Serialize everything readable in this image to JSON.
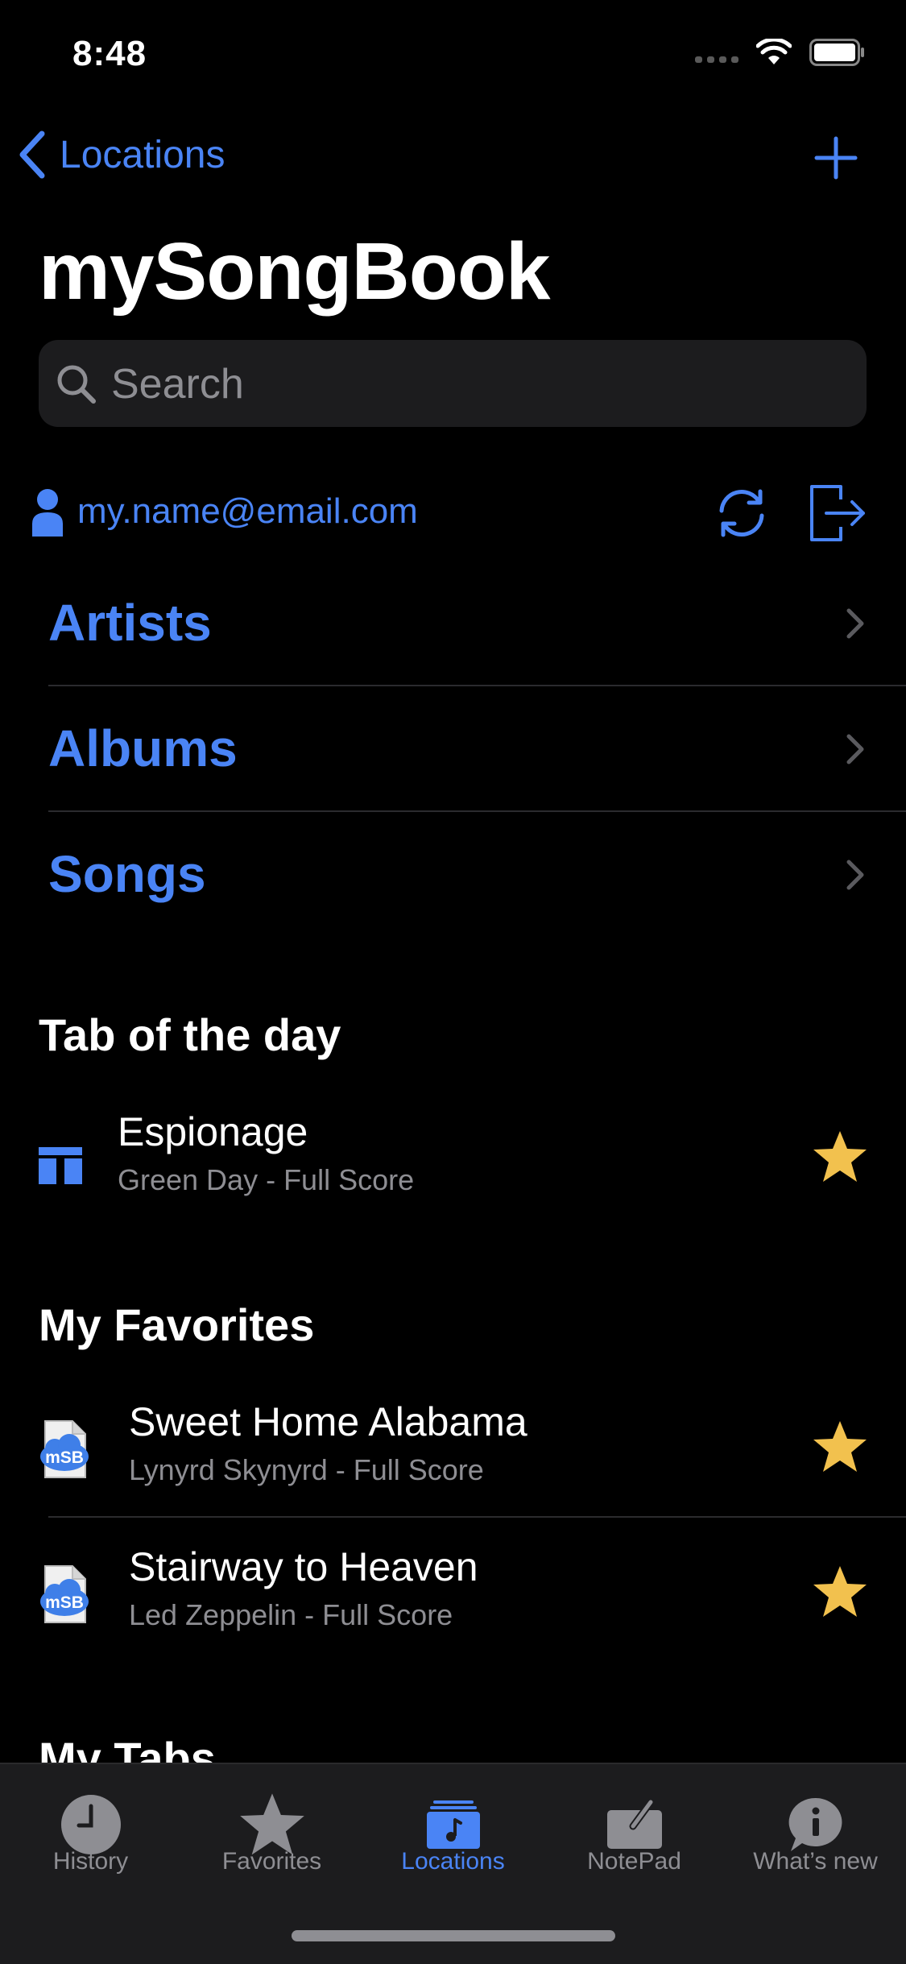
{
  "status": {
    "time": "8:48"
  },
  "nav": {
    "back_label": "Locations",
    "title": "mySongBook"
  },
  "search": {
    "placeholder": "Search",
    "value": ""
  },
  "account": {
    "email": "my.name@email.com"
  },
  "browse": [
    {
      "label": "Artists"
    },
    {
      "label": "Albums"
    },
    {
      "label": "Songs"
    }
  ],
  "tab_of_day": {
    "heading": "Tab of the day",
    "item": {
      "title": "Espionage",
      "subtitle": "Green Day - Full Score",
      "icon": "score-icon",
      "favorite": true
    }
  },
  "favorites": {
    "heading": "My Favorites",
    "items": [
      {
        "title": "Sweet Home Alabama",
        "subtitle": "Lynyrd Skynyrd - Full Score",
        "icon": "msb-file-icon",
        "badge": "mSB",
        "favorite": true
      },
      {
        "title": "Stairway to Heaven",
        "subtitle": "Led Zeppelin - Full Score",
        "icon": "msb-file-icon",
        "badge": "mSB",
        "favorite": true
      }
    ]
  },
  "my_tabs": {
    "heading": "My Tabs"
  },
  "tabbar": {
    "items": [
      {
        "label": "History",
        "icon": "clock-icon",
        "active": false
      },
      {
        "label": "Favorites",
        "icon": "star-icon",
        "active": false
      },
      {
        "label": "Locations",
        "icon": "folder-music-icon",
        "active": true
      },
      {
        "label": "NotePad",
        "icon": "notepad-icon",
        "active": false
      },
      {
        "label": "What’s new",
        "icon": "info-bubble-icon",
        "active": false
      }
    ]
  },
  "colors": {
    "accent": "#4a84f5",
    "star": "#f2c14e",
    "background": "#000000",
    "bar": "#1c1c1e"
  }
}
